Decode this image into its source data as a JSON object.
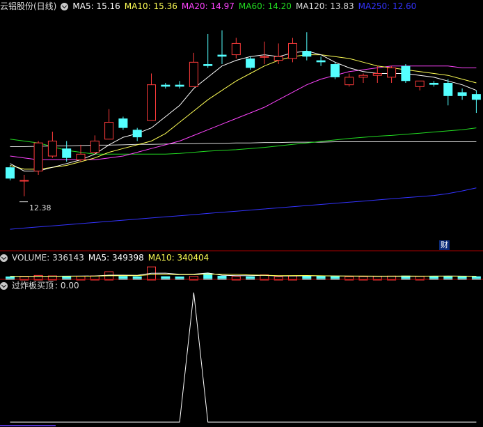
{
  "colors": {
    "background": "#000000",
    "up": "#ff3b3b",
    "down": "#54ffff",
    "ma5": "#ffffff",
    "ma10": "#ffff55",
    "ma20": "#ff44ff",
    "ma60": "#22dd22",
    "ma120": "#dddddd",
    "ma250": "#3333ff",
    "divider": "#aa0000",
    "indicator": "#ffffff"
  },
  "header_main": {
    "stock": "云铝股份(日线)",
    "ma5": "MA5: 15.16",
    "ma10": "MA10: 15.36",
    "ma20": "MA20: 14.97",
    "ma60": "MA60: 14.20",
    "ma120": "MA120: 13.83",
    "ma250": "MA250: 12.60"
  },
  "header_volume": {
    "title": "VOLUME: 336143",
    "ma5": "MA5: 349398",
    "ma10": "MA10: 340404"
  },
  "header_indicator": {
    "title": "过炸板买顶",
    "value": ": 0.00"
  },
  "annotations": {
    "low_marker": "12.38",
    "badge": "财"
  },
  "chart_data": [
    {
      "type": "candlestick",
      "panel": "price",
      "ylim": [
        11.0,
        17.2
      ],
      "candles": [
        {
          "o": 13.15,
          "h": 13.2,
          "c": 12.85,
          "l": 12.8
        },
        {
          "o": 12.8,
          "h": 12.95,
          "c": 12.8,
          "l": 12.38
        },
        {
          "o": 13.05,
          "h": 13.85,
          "c": 13.8,
          "l": 12.95
        },
        {
          "o": 13.45,
          "h": 14.1,
          "c": 13.85,
          "l": 13.4
        },
        {
          "o": 13.65,
          "h": 13.85,
          "c": 13.4,
          "l": 13.3
        },
        {
          "o": 13.35,
          "h": 13.75,
          "c": 13.5,
          "l": 13.3
        },
        {
          "o": 13.55,
          "h": 14.0,
          "c": 13.85,
          "l": 13.5
        },
        {
          "o": 13.9,
          "h": 14.7,
          "c": 14.35,
          "l": 13.9
        },
        {
          "o": 14.45,
          "h": 14.5,
          "c": 14.2,
          "l": 14.15
        },
        {
          "o": 14.15,
          "h": 14.2,
          "c": 13.95,
          "l": 13.85
        },
        {
          "o": 14.4,
          "h": 15.65,
          "c": 15.35,
          "l": 14.4
        },
        {
          "o": 15.35,
          "h": 15.4,
          "c": 15.3,
          "l": 15.25
        },
        {
          "o": 15.35,
          "h": 15.45,
          "c": 15.3,
          "l": 15.25
        },
        {
          "o": 15.3,
          "h": 16.2,
          "c": 15.95,
          "l": 15.3
        },
        {
          "o": 15.9,
          "h": 16.7,
          "c": 15.85,
          "l": 15.8
        },
        {
          "o": 16.15,
          "h": 16.8,
          "c": 16.1,
          "l": 15.9
        },
        {
          "o": 16.15,
          "h": 16.6,
          "c": 16.45,
          "l": 16.05
        },
        {
          "o": 16.05,
          "h": 16.1,
          "c": 15.8,
          "l": 15.75
        },
        {
          "o": 16.1,
          "h": 16.5,
          "c": 16.1,
          "l": 15.9
        },
        {
          "o": 16.0,
          "h": 16.45,
          "c": 16.1,
          "l": 15.9
        },
        {
          "o": 16.05,
          "h": 16.6,
          "c": 16.45,
          "l": 15.95
        },
        {
          "o": 16.25,
          "h": 16.75,
          "c": 16.1,
          "l": 16.0
        },
        {
          "o": 16.0,
          "h": 16.1,
          "c": 15.95,
          "l": 15.85
        },
        {
          "o": 15.9,
          "h": 15.95,
          "c": 15.55,
          "l": 15.5
        },
        {
          "o": 15.35,
          "h": 15.65,
          "c": 15.55,
          "l": 15.3
        },
        {
          "o": 15.55,
          "h": 15.65,
          "c": 15.6,
          "l": 15.4
        },
        {
          "o": 15.6,
          "h": 15.85,
          "c": 15.65,
          "l": 15.4
        },
        {
          "o": 15.55,
          "h": 15.85,
          "c": 15.8,
          "l": 15.4
        },
        {
          "o": 15.85,
          "h": 15.9,
          "c": 15.45,
          "l": 15.4
        },
        {
          "o": 15.3,
          "h": 15.4,
          "c": 15.45,
          "l": 15.2
        },
        {
          "o": 15.4,
          "h": 15.45,
          "c": 15.35,
          "l": 15.3
        },
        {
          "o": 15.4,
          "h": 15.5,
          "c": 15.05,
          "l": 14.8
        },
        {
          "o": 15.15,
          "h": 15.25,
          "c": 15.05,
          "l": 14.95
        },
        {
          "o": 15.1,
          "h": 15.2,
          "c": 14.95,
          "l": 14.6
        }
      ],
      "ma_lines": [
        {
          "name": "MA5",
          "values": [
            13.25,
            13.05,
            13.05,
            13.15,
            13.25,
            13.35,
            13.5,
            13.75,
            13.95,
            14.05,
            14.2,
            14.5,
            14.8,
            15.25,
            15.55,
            15.85,
            16.0,
            16.1,
            16.15,
            16.1,
            16.2,
            16.25,
            16.15,
            15.95,
            15.8,
            15.7,
            15.65,
            15.65,
            15.65,
            15.6,
            15.55,
            15.45,
            15.35,
            15.2
          ]
        },
        {
          "name": "MA10",
          "values": [
            13.2,
            13.1,
            13.1,
            13.15,
            13.2,
            13.3,
            13.4,
            13.55,
            13.65,
            13.75,
            13.85,
            14.05,
            14.35,
            14.65,
            14.95,
            15.2,
            15.45,
            15.65,
            15.85,
            16.0,
            16.1,
            16.15,
            16.15,
            16.1,
            16.05,
            15.95,
            15.85,
            15.8,
            15.75,
            15.7,
            15.65,
            15.6,
            15.5,
            15.4
          ]
        },
        {
          "name": "MA20",
          "values": [
            13.45,
            13.4,
            13.35,
            13.35,
            13.35,
            13.35,
            13.35,
            13.4,
            13.45,
            13.55,
            13.65,
            13.75,
            13.85,
            14.0,
            14.15,
            14.3,
            14.45,
            14.6,
            14.75,
            14.95,
            15.15,
            15.35,
            15.5,
            15.6,
            15.7,
            15.75,
            15.8,
            15.85,
            15.85,
            15.85,
            15.85,
            15.85,
            15.8,
            15.8
          ]
        },
        {
          "name": "MA60",
          "values": [
            13.9,
            13.85,
            13.8,
            13.7,
            13.6,
            13.55,
            13.5,
            13.5,
            13.5,
            13.5,
            13.5,
            13.5,
            13.52,
            13.55,
            13.58,
            13.6,
            13.62,
            13.65,
            13.68,
            13.72,
            13.76,
            13.8,
            13.84,
            13.88,
            13.92,
            13.95,
            13.98,
            14.0,
            14.03,
            14.06,
            14.09,
            14.12,
            14.15,
            14.2
          ]
        },
        {
          "name": "MA120",
          "values": [
            13.7,
            13.7,
            13.71,
            13.72,
            13.72,
            13.73,
            13.74,
            13.74,
            13.75,
            13.76,
            13.76,
            13.77,
            13.78,
            13.78,
            13.79,
            13.79,
            13.8,
            13.8,
            13.81,
            13.81,
            13.82,
            13.82,
            13.82,
            13.83,
            13.83,
            13.83,
            13.83,
            13.83,
            13.83,
            13.83,
            13.83,
            13.83,
            13.83,
            13.83
          ]
        },
        {
          "name": "MA250",
          "values": [
            11.5,
            11.53,
            11.56,
            11.59,
            11.62,
            11.65,
            11.68,
            11.71,
            11.74,
            11.77,
            11.8,
            11.83,
            11.86,
            11.89,
            11.92,
            11.95,
            11.98,
            12.01,
            12.04,
            12.07,
            12.1,
            12.13,
            12.16,
            12.19,
            12.22,
            12.25,
            12.28,
            12.31,
            12.34,
            12.37,
            12.4,
            12.45,
            12.52,
            12.6
          ]
        }
      ]
    },
    {
      "type": "bar",
      "panel": "volume",
      "ylim": [
        0,
        1400000
      ],
      "values": [
        320000,
        300000,
        420000,
        380000,
        360000,
        340000,
        380000,
        760000,
        360000,
        330000,
        1200000,
        340000,
        320000,
        330000,
        620000,
        390000,
        330000,
        330000,
        470000,
        300000,
        370000,
        400000,
        350000,
        370000,
        300000,
        310000,
        330000,
        360000,
        400000,
        330000,
        360000,
        350000,
        340000,
        336143
      ],
      "ma_lines": [
        {
          "name": "MA5",
          "values": [
            330000,
            330000,
            340000,
            350000,
            356000,
            360000,
            376000,
            448000,
            444000,
            434000,
            626000,
            628000,
            530000,
            536000,
            640000,
            440000,
            398000,
            398000,
            428000,
            364000,
            378000,
            380000,
            380000,
            378000,
            358000,
            346000,
            332000,
            338000,
            340000,
            346000,
            354000,
            360000,
            358000,
            349398
          ]
        },
        {
          "name": "MA10",
          "values": [
            330000,
            330000,
            335000,
            340000,
            345000,
            348000,
            355000,
            390000,
            395000,
            395000,
            490000,
            500000,
            490000,
            490000,
            540000,
            535000,
            515000,
            465000,
            436000,
            402000,
            410000,
            414000,
            390000,
            372000,
            360000,
            360000,
            357000,
            357000,
            362000,
            355000,
            355000,
            355000,
            350000,
            340404
          ]
        }
      ]
    },
    {
      "type": "line",
      "panel": "indicator",
      "ylim": [
        0,
        1
      ],
      "values": [
        0,
        0,
        0,
        0,
        0,
        0,
        0,
        0,
        0,
        0,
        0,
        0,
        0,
        1,
        0,
        0,
        0,
        0,
        0,
        0,
        0,
        0,
        0,
        0,
        0,
        0,
        0,
        0,
        0,
        0,
        0,
        0,
        0,
        0
      ]
    }
  ]
}
